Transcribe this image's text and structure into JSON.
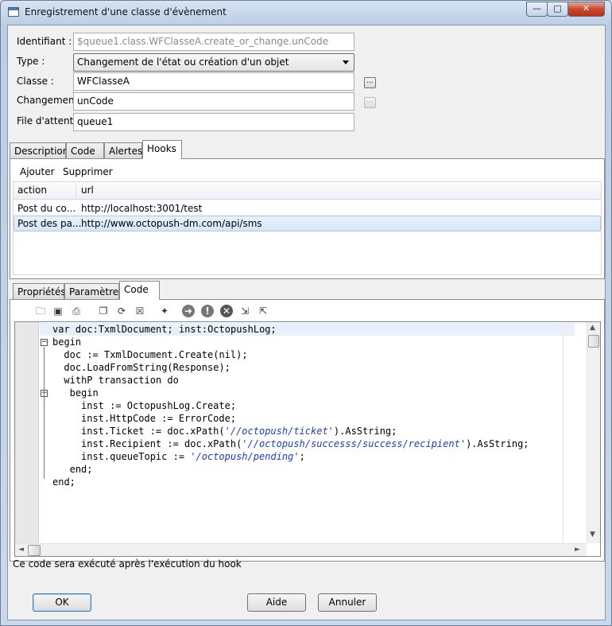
{
  "window": {
    "title": "Enregistrement d'une classe d'évènement",
    "minimize_glyph": "—",
    "maximize_glyph": "□",
    "close_glyph": "✕"
  },
  "form": {
    "identifiant_label": "Identifiant :",
    "identifiant_value": "$queue1.class.WFClasseA.create_or_change.unCode",
    "type_label": "Type :",
    "type_value": "Changement de l'état ou création d'un objet",
    "classe_label": "Classe :",
    "classe_value": "WFClasseA",
    "changement_label": "Changement",
    "changement_value": "unCode",
    "file_label": "File d'attente",
    "file_value": "queue1",
    "browse_glyph": "..."
  },
  "top_tabs": [
    {
      "label": "Description"
    },
    {
      "label": "Code"
    },
    {
      "label": "Alertes"
    },
    {
      "label": "Hooks"
    }
  ],
  "hooks": {
    "add_label": "Ajouter",
    "delete_label": "Supprimer",
    "columns": [
      "action",
      "url"
    ],
    "rows": [
      {
        "action": "Post du co...",
        "url": "http://localhost:3001/test"
      },
      {
        "action": "Post des pa...",
        "url": "http://www.octopush-dm.com/api/sms"
      }
    ]
  },
  "bottom_tabs": [
    {
      "label": "Propriétés"
    },
    {
      "label": "Paramètres"
    },
    {
      "label": "Code"
    }
  ],
  "toolbar_icons": [
    {
      "name": "open-folder-icon",
      "glyph": "🗀"
    },
    {
      "name": "save-icon",
      "glyph": "▣"
    },
    {
      "name": "print-icon",
      "glyph": "⎙"
    },
    {
      "name": "copy-icon",
      "glyph": "❐"
    },
    {
      "name": "refresh-icon",
      "glyph": "⟳"
    },
    {
      "name": "clear-icon",
      "glyph": "☒"
    },
    {
      "name": "wizard-icon",
      "glyph": "✦"
    },
    {
      "name": "run-icon",
      "glyph": "➜"
    },
    {
      "name": "info-icon",
      "glyph": "!"
    },
    {
      "name": "stop-icon",
      "glyph": "✕"
    },
    {
      "name": "export-icon",
      "glyph": "⇲"
    },
    {
      "name": "import-icon",
      "glyph": "⇱"
    }
  ],
  "code_lines": [
    {
      "indent": 0,
      "parts": [
        {
          "t": "var doc:TxmlDocument; inst:OctopushLog;"
        }
      ]
    },
    {
      "indent": 0,
      "parts": [
        {
          "t": "begin"
        }
      ]
    },
    {
      "indent": 2,
      "parts": [
        {
          "t": "doc := TxmlDocument.Create(nil);"
        }
      ]
    },
    {
      "indent": 2,
      "parts": [
        {
          "t": "doc.LoadFromString(Response);"
        }
      ]
    },
    {
      "indent": 2,
      "parts": [
        {
          "t": "withP transaction do"
        }
      ]
    },
    {
      "indent": 3,
      "parts": [
        {
          "t": "begin"
        }
      ]
    },
    {
      "indent": 5,
      "parts": [
        {
          "t": "inst := OctopushLog.Create;"
        }
      ]
    },
    {
      "indent": 5,
      "parts": [
        {
          "t": "inst.HttpCode := ErrorCode;"
        }
      ]
    },
    {
      "indent": 5,
      "parts": [
        {
          "t": "inst.Ticket := doc.xPath("
        },
        {
          "t": "'//octopush/ticket'",
          "s": 1
        },
        {
          "t": ").AsString;"
        }
      ]
    },
    {
      "indent": 5,
      "parts": [
        {
          "t": "inst.Recipient := doc.xPath("
        },
        {
          "t": "'//octopush/successs/success/recipient'",
          "s": 1
        },
        {
          "t": ").AsString;"
        }
      ]
    },
    {
      "indent": 5,
      "parts": [
        {
          "t": "inst.queueTopic := "
        },
        {
          "t": "'/octopush/pending'",
          "s": 1
        },
        {
          "t": ";"
        }
      ]
    },
    {
      "indent": 3,
      "parts": [
        {
          "t": "end;"
        }
      ]
    },
    {
      "indent": 0,
      "parts": [
        {
          "t": "end;"
        }
      ]
    }
  ],
  "fold_glyph": "−",
  "status_text": "Ce code sera exécuté après l'exécution du hook",
  "buttons": {
    "ok": "OK",
    "aide": "Aide",
    "annuler": "Annuler"
  },
  "scroll": {
    "up": "▲",
    "down": "▼",
    "left": "◄",
    "right": "►"
  }
}
